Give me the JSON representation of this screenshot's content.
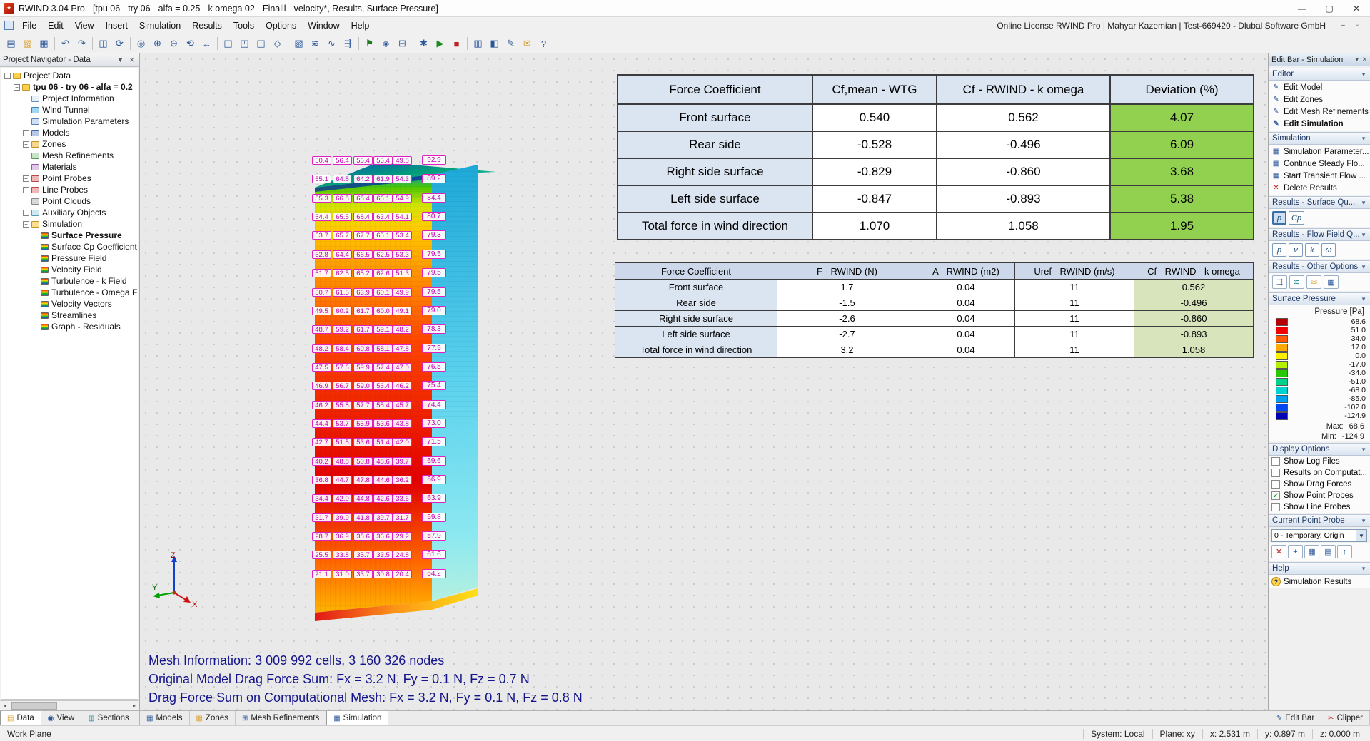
{
  "titlebar": {
    "title": "RWIND 3.04 Pro - [tpu 06 - try 06 - alfa = 0.25 - k omega 02 - Finalll -  velocity*, Results, Surface Pressure]"
  },
  "menubar": {
    "items": [
      "File",
      "Edit",
      "View",
      "Insert",
      "Simulation",
      "Results",
      "Tools",
      "Options",
      "Window",
      "Help"
    ],
    "license": "Online License RWIND Pro | Mahyar Kazemian | Test-669420 - Dlubal Software GmbH"
  },
  "toolbar": {
    "items": [
      {
        "g": "▤",
        "n": "new-project"
      },
      {
        "g": "▧",
        "n": "open-project",
        "c": "#d89c28"
      },
      {
        "g": "▦",
        "n": "save-project"
      },
      "|",
      {
        "g": "↶",
        "n": "undo"
      },
      {
        "g": "↷",
        "n": "redo"
      },
      "|",
      {
        "g": "◫",
        "n": "copy-graphic"
      },
      {
        "g": "⟳",
        "n": "regenerate-model"
      },
      "|",
      {
        "g": "◎",
        "n": "zoom-window"
      },
      {
        "g": "⊕",
        "n": "zoom-in"
      },
      {
        "g": "⊖",
        "n": "zoom-out"
      },
      {
        "g": "⟲",
        "n": "rotate-view"
      },
      {
        "g": "↔",
        "n": "pan-view"
      },
      "|",
      {
        "g": "◰",
        "n": "view-front"
      },
      {
        "g": "◳",
        "n": "view-side"
      },
      {
        "g": "◲",
        "n": "view-top"
      },
      {
        "g": "◇",
        "n": "view-isometric"
      },
      "|",
      {
        "g": "▨",
        "n": "show-mesh"
      },
      {
        "g": "≋",
        "n": "streamlines"
      },
      {
        "g": "∿",
        "n": "velocity-field"
      },
      {
        "g": "⇶",
        "n": "velocity-vectors"
      },
      "|",
      {
        "g": "⚑",
        "n": "point-probe",
        "c": "#1f7a1f"
      },
      {
        "g": "◈",
        "n": "clipping-plane"
      },
      {
        "g": "⊟",
        "n": "section-plane"
      },
      "|",
      {
        "g": "✱",
        "n": "simulation-settings"
      },
      {
        "g": "▶",
        "n": "start-simulation",
        "c": "#1e8a1e"
      },
      {
        "g": "■",
        "n": "stop-simulation",
        "c": "#c02020"
      },
      "|",
      {
        "g": "▥",
        "n": "result-tables"
      },
      {
        "g": "◧",
        "n": "color-scale"
      },
      {
        "g": "✎",
        "n": "edit-mode"
      },
      {
        "g": "✉",
        "n": "send-message",
        "c": "#d89c28"
      },
      {
        "g": "?",
        "n": "help"
      }
    ]
  },
  "navigator": {
    "title": "Project Navigator - Data",
    "tree": [
      {
        "label": "Project Data",
        "level": 0,
        "icon": "folder",
        "expand": "minus"
      },
      {
        "label": "tpu 06 - try 06 - alfa = 0.2",
        "level": 1,
        "icon": "folder",
        "expand": "minus",
        "bold": true
      },
      {
        "label": "Project Information",
        "level": 2,
        "icon": "doc"
      },
      {
        "label": "Wind Tunnel",
        "level": 2,
        "icon": "wind"
      },
      {
        "label": "Simulation Parameters",
        "level": 2,
        "icon": "params"
      },
      {
        "label": "Models",
        "level": 2,
        "icon": "models",
        "expand": "plus"
      },
      {
        "label": "Zones",
        "level": 2,
        "icon": "zones",
        "expand": "plus"
      },
      {
        "label": "Mesh Refinements",
        "level": 2,
        "icon": "mesh"
      },
      {
        "label": "Materials",
        "level": 2,
        "icon": "materials"
      },
      {
        "label": "Point Probes",
        "level": 2,
        "icon": "probe",
        "expand": "plus"
      },
      {
        "label": "Line Probes",
        "level": 2,
        "icon": "probe",
        "expand": "plus"
      },
      {
        "label": "Point Clouds",
        "level": 2,
        "icon": "cloud"
      },
      {
        "label": "Auxiliary Objects",
        "level": 2,
        "icon": "aux",
        "expand": "plus"
      },
      {
        "label": "Simulation",
        "level": 2,
        "icon": "sim",
        "expand": "minus"
      },
      {
        "label": "Surface Pressure",
        "level": 3,
        "icon": "result",
        "bold": true
      },
      {
        "label": "Surface Cp Coefficient",
        "level": 3,
        "icon": "result"
      },
      {
        "label": "Pressure Field",
        "level": 3,
        "icon": "result"
      },
      {
        "label": "Velocity Field",
        "level": 3,
        "icon": "result"
      },
      {
        "label": "Turbulence - k Field",
        "level": 3,
        "icon": "result"
      },
      {
        "label": "Turbulence - Omega Fi...",
        "level": 3,
        "icon": "result"
      },
      {
        "label": "Velocity Vectors",
        "level": 3,
        "icon": "result"
      },
      {
        "label": "Streamlines",
        "level": 3,
        "icon": "result"
      },
      {
        "label": "Graph - Residuals",
        "level": 3,
        "icon": "result"
      }
    ]
  },
  "viewport": {
    "coef_table": {
      "widths": [
        273,
        174,
        243,
        201
      ],
      "headers": [
        "Force Coefficient",
        "Cf,mean - WTG",
        "Cf - RWIND - k omega",
        "Deviation (%)"
      ],
      "rows": [
        [
          "Front surface",
          "0.540",
          "0.562",
          "4.07"
        ],
        [
          "Rear side",
          "-0.528",
          "-0.496",
          "6.09"
        ],
        [
          "Right side surface",
          "-0.829",
          "-0.860",
          "3.68"
        ],
        [
          "Left side surface",
          "-0.847",
          "-0.893",
          "5.38"
        ],
        [
          "Total force in wind direction",
          "1.070",
          "1.058",
          "1.95"
        ]
      ]
    },
    "force_table": {
      "widths": [
        227,
        196,
        137,
        167,
        167
      ],
      "headers": [
        "Force Coefficient",
        "F - RWIND (N)",
        "A - RWIND (m2)",
        "Uref - RWIND (m/s)",
        "Cf - RWIND - k omega"
      ],
      "rows": [
        [
          "Front surface",
          "1.7",
          "0.04",
          "11",
          "0.562"
        ],
        [
          "Rear side",
          "-1.5",
          "0.04",
          "11",
          "-0.496"
        ],
        [
          "Right side surface",
          "-2.6",
          "0.04",
          "11",
          "-0.860"
        ],
        [
          "Left side surface",
          "-2.7",
          "0.04",
          "11",
          "-0.893"
        ],
        [
          "Total force in wind direction",
          "3.2",
          "0.04",
          "11",
          "1.058"
        ]
      ]
    },
    "mesh_info": [
      "Mesh Information: 3 009 992 cells, 3 160 326 nodes",
      "Original Model Drag Force Sum: Fx = 3.2 N, Fy = 0.1 N, Fz = 0.7 N",
      "Drag Force Sum on Computational Mesh: Fx = 3.2 N, Fy = 0.1 N, Fz = 0.8 N"
    ],
    "axis": {
      "x": "X",
      "y": "Y",
      "z": "Z"
    },
    "probe_rows": [
      {
        "front": [
          "50.4",
          "56.4",
          "56.4",
          "55.4",
          "49.8"
        ],
        "side": "92.9"
      },
      {
        "front": [
          "55.1",
          "64.8",
          "64.2",
          "61.9",
          "54.3"
        ],
        "side": "89.2"
      },
      {
        "front": [
          "55.3",
          "66.8",
          "68.4",
          "66.1",
          "54.9"
        ],
        "side": "84.4"
      },
      {
        "front": [
          "54.4",
          "65.5",
          "68.4",
          "63.4",
          "54.1"
        ],
        "side": "80.7"
      },
      {
        "front": [
          "53.7",
          "65.7",
          "67.7",
          "65.1",
          "53.4"
        ],
        "side": "79.3"
      },
      {
        "front": [
          "52.8",
          "64.4",
          "66.5",
          "62.5",
          "53.3"
        ],
        "side": "79.5"
      },
      {
        "front": [
          "51.7",
          "62.5",
          "65.2",
          "62.6",
          "51.3"
        ],
        "side": "79.5"
      },
      {
        "front": [
          "50.7",
          "61.5",
          "63.9",
          "60.1",
          "49.9"
        ],
        "side": "79.5"
      },
      {
        "front": [
          "49.5",
          "60.2",
          "61.7",
          "60.0",
          "49.1"
        ],
        "side": "79.0"
      },
      {
        "front": [
          "48.7",
          "59.2",
          "61.7",
          "59.1",
          "48.2"
        ],
        "side": "78.3"
      },
      {
        "front": [
          "48.2",
          "58.4",
          "60.8",
          "58.1",
          "47.8"
        ],
        "side": "77.5"
      },
      {
        "front": [
          "47.5",
          "57.6",
          "59.9",
          "57.4",
          "47.0"
        ],
        "side": "76.5"
      },
      {
        "front": [
          "46.9",
          "56.7",
          "59.0",
          "56.4",
          "46.2"
        ],
        "side": "75.4"
      },
      {
        "front": [
          "46.2",
          "55.8",
          "57.7",
          "55.4",
          "45.7"
        ],
        "side": "74.4"
      },
      {
        "front": [
          "44.4",
          "53.7",
          "55.9",
          "53.6",
          "43.8"
        ],
        "side": "73.0"
      },
      {
        "front": [
          "42.7",
          "51.5",
          "53.6",
          "51.4",
          "42.0"
        ],
        "side": "71.5"
      },
      {
        "front": [
          "40.2",
          "48.8",
          "50.8",
          "48.6",
          "39.7"
        ],
        "side": "69.6"
      },
      {
        "front": [
          "36.8",
          "44.7",
          "47.8",
          "44.6",
          "36.2"
        ],
        "side": "66.9"
      },
      {
        "front": [
          "34.4",
          "42.0",
          "44.8",
          "42.6",
          "33.6"
        ],
        "side": "63.9"
      },
      {
        "front": [
          "31.7",
          "39.9",
          "41.8",
          "39.7",
          "31.7"
        ],
        "side": "59.8"
      },
      {
        "front": [
          "28.7",
          "36.9",
          "38.6",
          "36.6",
          "29.2"
        ],
        "side": "57.9"
      },
      {
        "front": [
          "25.5",
          "33.8",
          "35.7",
          "33.5",
          "24.8"
        ],
        "side": "61.6"
      },
      {
        "front": [
          "21.1",
          "31.0",
          "33.7",
          "30.8",
          "20.4"
        ],
        "side": "64.2"
      }
    ]
  },
  "editbar": {
    "title": "Edit Bar - Simulation",
    "sections": {
      "editor": {
        "header": "Editor",
        "items": [
          {
            "label": "Edit Model",
            "g": "✎"
          },
          {
            "label": "Edit Zones",
            "g": "✎"
          },
          {
            "label": "Edit Mesh Refinements",
            "g": "✎"
          },
          {
            "label": "Edit Simulation",
            "g": "✎",
            "bold": true
          }
        ]
      },
      "simulation": {
        "header": "Simulation",
        "items": [
          {
            "label": "Simulation Parameter...",
            "g": "▦"
          },
          {
            "label": "Continue Steady Flo...",
            "g": "▦"
          },
          {
            "label": "Start Transient Flow ...",
            "g": "▦"
          },
          {
            "label": "Delete Results",
            "g": "✕",
            "c": "#c02020"
          }
        ]
      },
      "results_surface": {
        "header": "Results - Surface Qu...",
        "buttons": [
          {
            "label": "p",
            "active": true
          },
          {
            "label": "Cp"
          }
        ]
      },
      "results_flow": {
        "header": "Results - Flow Field Q...",
        "buttons": [
          {
            "label": "p"
          },
          {
            "label": "v"
          },
          {
            "label": "k"
          },
          {
            "label": "ω"
          }
        ]
      },
      "results_other": {
        "header": "Results - Other Options",
        "icons": [
          {
            "g": "⇶",
            "n": "result-vectors",
            "c": "#2b579a"
          },
          {
            "g": "≋",
            "n": "result-isosurfaces",
            "c": "#148696"
          },
          {
            "g": "✉",
            "n": "result-export",
            "c": "#d89c28"
          },
          {
            "g": "▦",
            "n": "result-grid",
            "c": "#2b579a"
          }
        ]
      },
      "surface_pressure": {
        "header": "Surface Pressure",
        "unit": "Pressure [Pa]",
        "scale": [
          [
            "#b40000",
            "68.6"
          ],
          [
            "#f00000",
            "51.0"
          ],
          [
            "#ff5a00",
            "34.0"
          ],
          [
            "#ffaa00",
            "17.0"
          ],
          [
            "#fff000",
            "0.0"
          ],
          [
            "#b4f000",
            "-17.0"
          ],
          [
            "#28c800",
            "-34.0"
          ],
          [
            "#00d28c",
            "-51.0"
          ],
          [
            "#00d2d2",
            "-68.0"
          ],
          [
            "#00a0f0",
            "-85.0"
          ],
          [
            "#0046f0",
            "-102.0"
          ],
          [
            "#0000b4",
            "-124.9"
          ]
        ],
        "max_label": "Max:",
        "max": "68.6",
        "min_label": "Min:",
        "min": "-124.9"
      },
      "display_options": {
        "header": "Display Options",
        "checks": [
          {
            "label": "Show Log Files",
            "checked": false
          },
          {
            "label": "Results on Computat...",
            "checked": false
          },
          {
            "label": "Show Drag Forces",
            "checked": false
          },
          {
            "label": "Show Point Probes",
            "checked": true
          },
          {
            "label": "Show Line Probes",
            "checked": false
          }
        ]
      },
      "current_probe": {
        "header": "Current Point Probe",
        "value": "0 - Temporary, Origin",
        "buttons": [
          {
            "g": "✕",
            "n": "delete-probe",
            "c": "#c02020"
          },
          {
            "g": "+",
            "n": "add-probe",
            "c": "#2b579a"
          },
          {
            "g": "▦",
            "n": "probe-table",
            "c": "#2b579a"
          },
          {
            "g": "▤",
            "n": "probe-list",
            "c": "#2b579a"
          },
          {
            "g": "↑",
            "n": "probe-up",
            "c": "#2b579a"
          }
        ]
      },
      "help": {
        "header": "Help",
        "item": "Simulation Results"
      }
    }
  },
  "tabs": {
    "left": [
      {
        "label": "Data",
        "icon": "▤",
        "c": "#d89c28",
        "active": true
      },
      {
        "label": "View",
        "icon": "◉",
        "c": "#2b579a"
      },
      {
        "label": "Sections",
        "icon": "▥",
        "c": "#148696"
      }
    ],
    "main": [
      {
        "label": "Models",
        "icon": "▦",
        "c": "#2b579a"
      },
      {
        "label": "Zones",
        "icon": "▦",
        "c": "#d89c28"
      },
      {
        "label": "Mesh Refinements",
        "icon": "⊞",
        "c": "#2b579a"
      },
      {
        "label": "Simulation",
        "icon": "▦",
        "c": "#2b579a",
        "active": true
      }
    ],
    "right": [
      {
        "label": "Edit Bar",
        "icon": "✎",
        "c": "#2b579a"
      },
      {
        "label": "Clipper",
        "icon": "✂",
        "c": "#c02020"
      }
    ]
  },
  "statusbar": {
    "left": "Work Plane",
    "items": [
      "System: Local",
      "Plane: xy",
      "x: 2.531 m",
      "y: 0.897 m",
      "z: 0.000 m"
    ]
  }
}
